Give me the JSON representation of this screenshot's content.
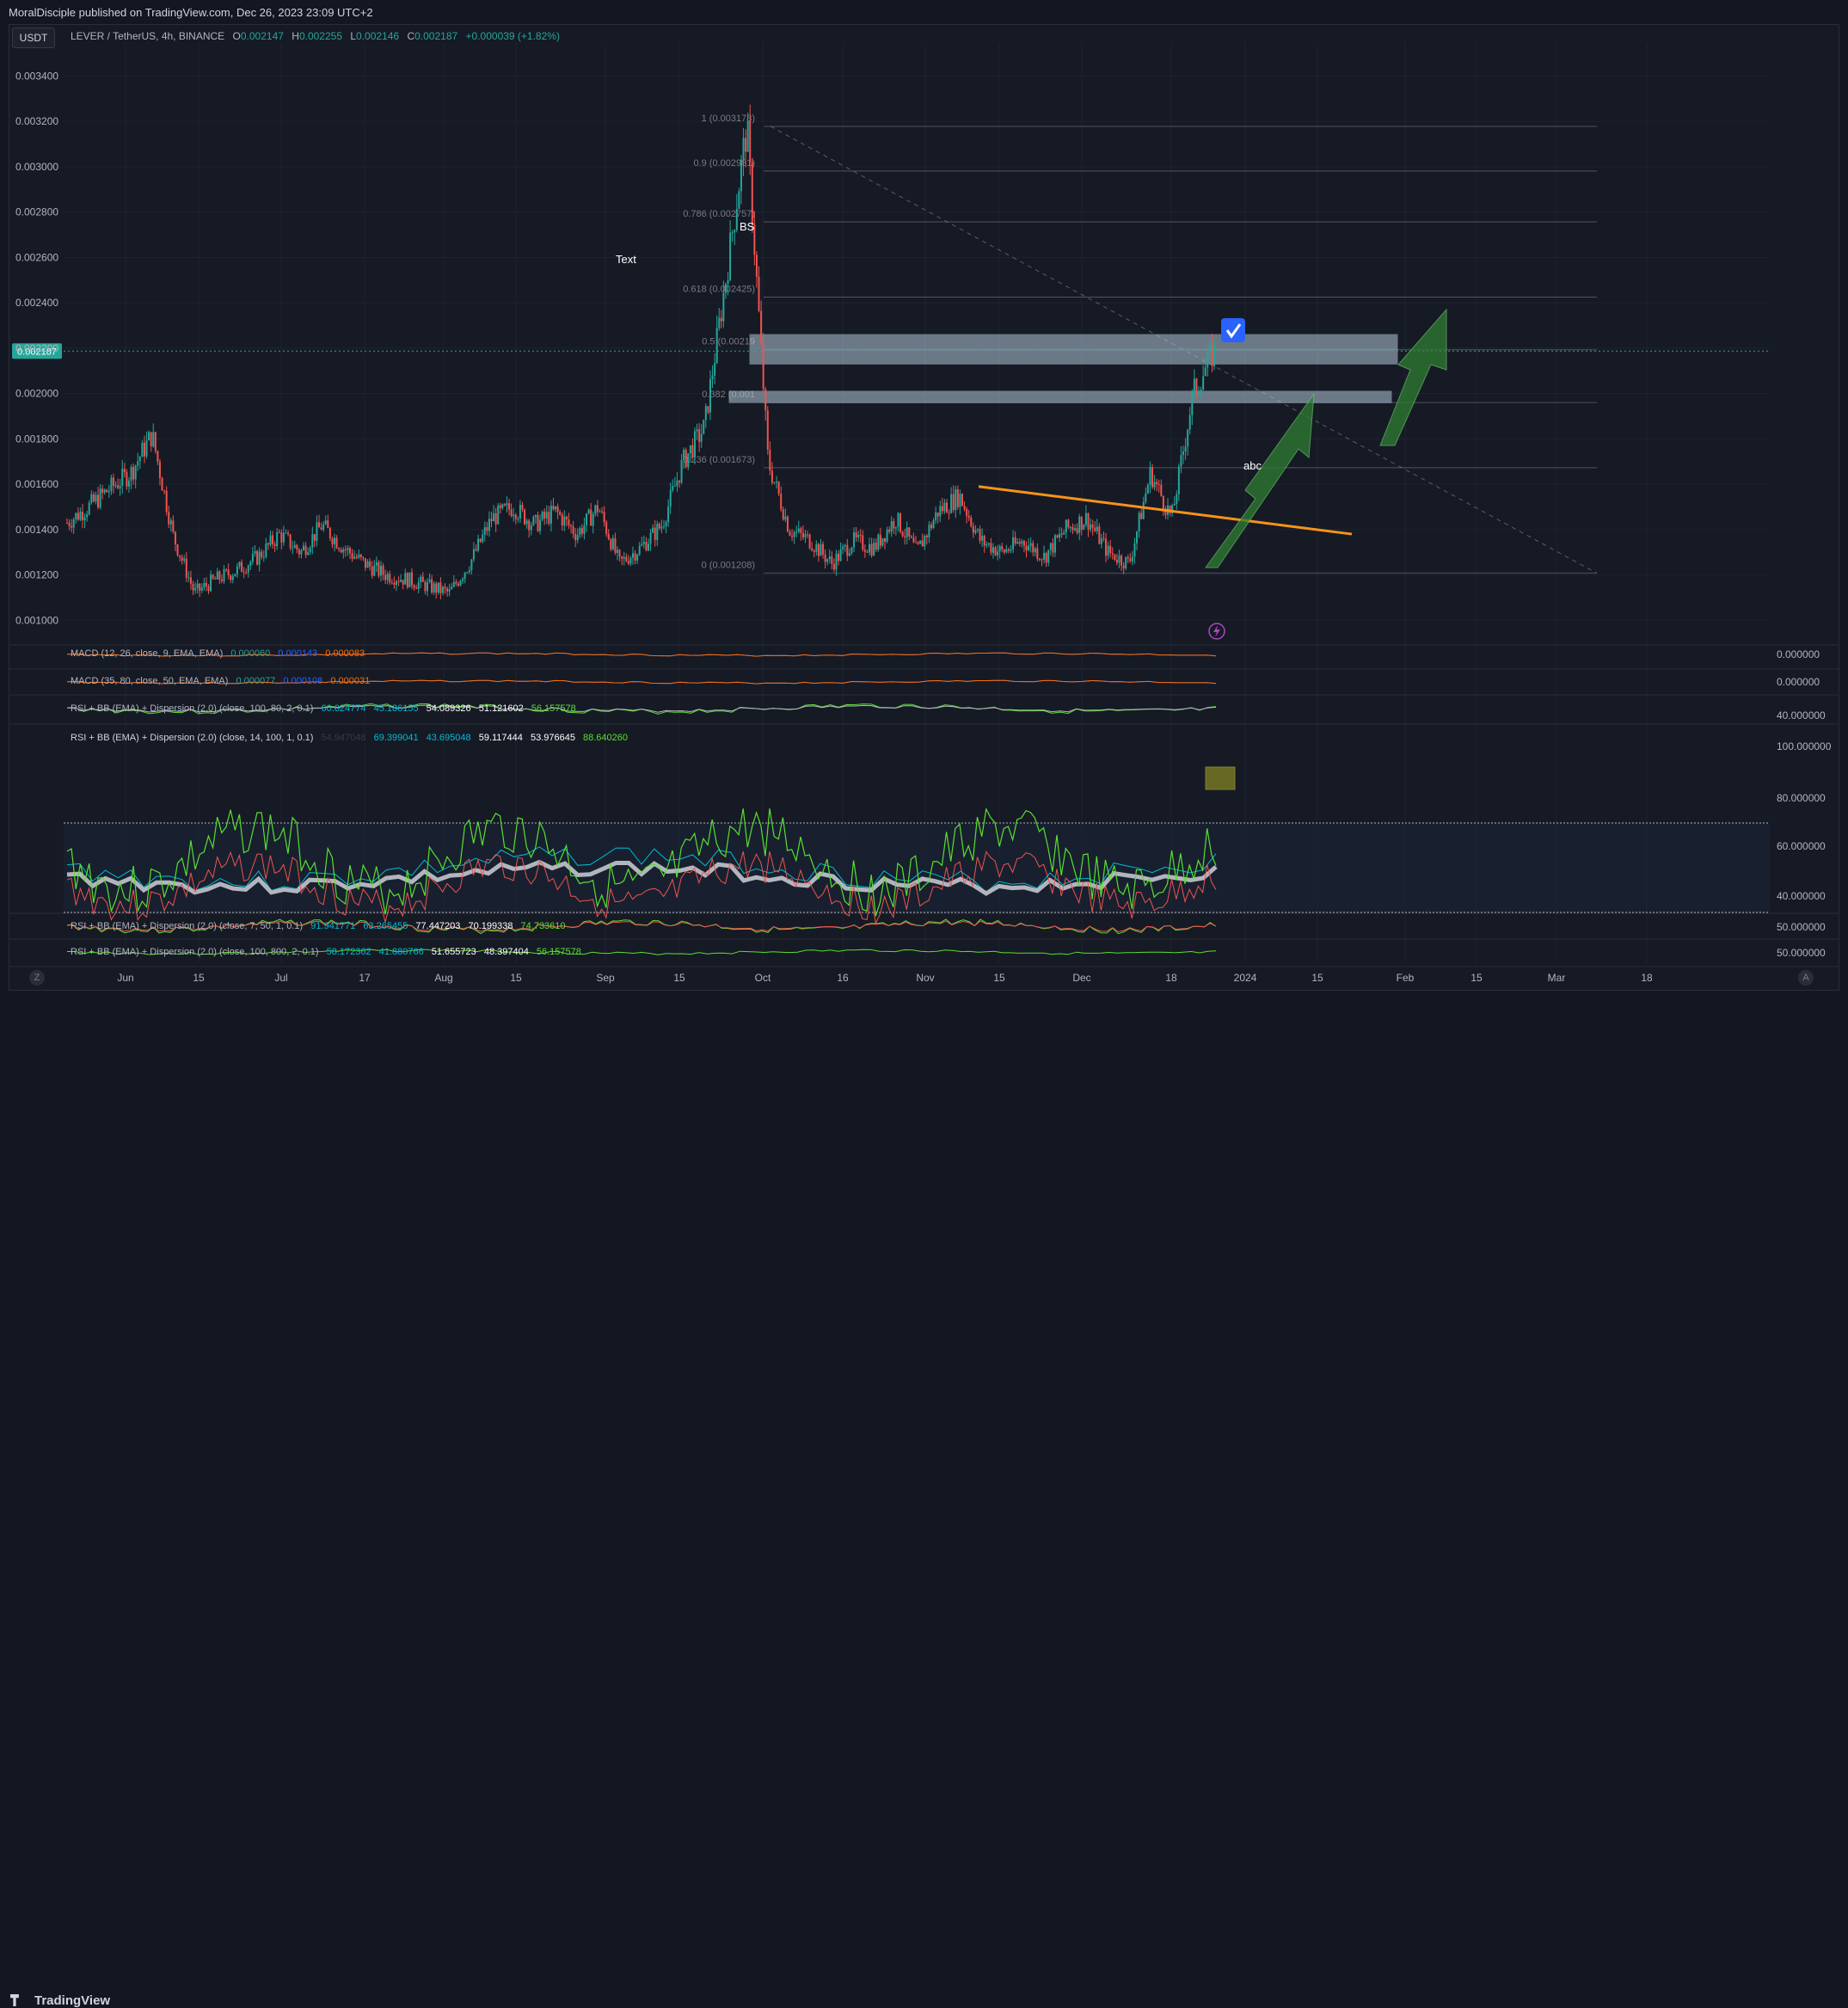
{
  "header": {
    "published": "MoralDisciple published on TradingView.com, Dec 26, 2023 23:09 UTC+2",
    "currency_button": "USDT"
  },
  "legend": {
    "symbol": "LEVER / TetherUS, 4h, BINANCE",
    "open_label": "O",
    "open": "0.002147",
    "high_label": "H",
    "high": "0.002255",
    "low_label": "L",
    "low": "0.002146",
    "close_label": "C",
    "close": "0.002187",
    "change": "+0.000039 (+1.82%)"
  },
  "indicators": [
    {
      "name": "MACD (12, 26, close, 9, EMA, EMA)",
      "values": [
        "0.000060",
        "0.000143",
        "0.000083"
      ],
      "axis_value": "0.000000"
    },
    {
      "name": "MACD (35, 80, close, 50, EMA, EMA)",
      "values": [
        "0.000077",
        "0.000108",
        "0.000031"
      ],
      "axis_value": "0.000000"
    },
    {
      "name": "RSI + BB (EMA) + Dispersion (2.0) (close, 100, 80, 2, 0.1)",
      "values": [
        "60.024774",
        "45.186155",
        "54.089326",
        "51.121602",
        "56.157578"
      ],
      "axis_value": "40.000000"
    },
    {
      "name": "RSI + BB (EMA) + Dispersion (2.0) (close, 14, 100, 1, 0.1)",
      "values": [
        "54.947048",
        "69.399041",
        "43.695048",
        "59.117444",
        "53.976645",
        "88.640260"
      ],
      "axis_values": [
        "100.000000",
        "80.000000",
        "60.000000",
        "40.000000"
      ]
    },
    {
      "name": "RSI + BB (EMA) + Dispersion (2.0) (close, 7, 50, 1, 0.1)",
      "values": [
        "91.941771",
        "63.265455",
        "77.447203",
        "70.199338",
        "74.733610"
      ],
      "axis_value": "50.000000"
    },
    {
      "name": "RSI + BB (EMA) + Dispersion (2.0) (close, 100, 800, 2, 0.1)",
      "values": [
        "58.172362",
        "41.880766",
        "51.655723",
        "48.397404",
        "56.157578"
      ],
      "axis_value": "50.000000"
    }
  ],
  "price_tag": "0.002187",
  "annotations": {
    "text1": "Text",
    "text2": "BS",
    "text3": "abc"
  },
  "fib_levels": [
    {
      "ratio": "1",
      "price": "0.003178",
      "label": "1 (0.003178)"
    },
    {
      "ratio": "0.9",
      "price": "0.002981",
      "label": "0.9 (0.002981)"
    },
    {
      "ratio": "0.786",
      "price": "0.002757",
      "label": "0.786 (0.002757)"
    },
    {
      "ratio": "0.618",
      "price": "0.002425",
      "label": "0.618 (0.002425)"
    },
    {
      "ratio": "0.5",
      "price": "0.002193",
      "label": "0.5 (0.00219"
    },
    {
      "ratio": "0.382",
      "price": "0.001960",
      "label": "0.382 (0.001"
    },
    {
      "ratio": "0.236",
      "price": "0.001673",
      "label": "0.236 (0.001673)"
    },
    {
      "ratio": "0",
      "price": "0.001208",
      "label": "0 (0.001208)"
    }
  ],
  "footer": {
    "brand": "TradingView",
    "left_btn": "Z",
    "right_btn": "A"
  },
  "colors": {
    "up": "#26a69a",
    "down": "#ef5350",
    "fib": "#787b86",
    "trendline": "#f7931a",
    "arrow": "#2e7d32",
    "zone": "#b2c7d8",
    "rsi_line": "#5adf30"
  },
  "chart_data": {
    "type": "candlestick",
    "y_axis": {
      "ylim": [
        0.00091,
        0.00347
      ],
      "ticks": [
        "0.001000",
        "0.001200",
        "0.001400",
        "0.001600",
        "0.001800",
        "0.002000",
        "0.002200",
        "0.002400",
        "0.002600",
        "0.002800",
        "0.003000",
        "0.003200",
        "0.003400"
      ]
    },
    "x_axis": {
      "ticks": [
        "Jun",
        "15",
        "Jul",
        "17",
        "Aug",
        "15",
        "Sep",
        "15",
        "Oct",
        "16",
        "Nov",
        "15",
        "Dec",
        "18",
        "2024",
        "15",
        "Feb",
        "15",
        "Mar",
        "18"
      ]
    },
    "price_series": {
      "name": "LEVER / TetherUS",
      "dates": [
        "May 22",
        "May 26",
        "Jun 1",
        "Jun 4",
        "Jun 8",
        "Jun 10",
        "Jun 15",
        "Jun 20",
        "Jun 25",
        "Jul 1",
        "Jul 8",
        "Jul 14",
        "Jul 17",
        "Jul 22",
        "Jul 27",
        "Aug 1",
        "Aug 5",
        "Aug 10",
        "Aug 14",
        "Aug 17",
        "Aug 20",
        "Aug 25",
        "Aug 30",
        "Sep 4",
        "Sep 8",
        "Sep 12",
        "Sep 17",
        "Sep 21",
        "Sep 24",
        "Sep 28",
        "Oct 1",
        "Oct 3",
        "Oct 5",
        "Oct 8",
        "Oct 12",
        "Oct 17",
        "Oct 21",
        "Oct 26",
        "Oct 31",
        "Nov 4",
        "Nov 8",
        "Nov 12",
        "Nov 16",
        "Nov 20",
        "Nov 24",
        "Nov 29",
        "Dec 3",
        "Dec 8",
        "Dec 12",
        "Dec 15",
        "Dec 18",
        "Dec 20",
        "Dec 22",
        "Dec 24",
        "Dec 26"
      ],
      "close": [
        0.00143,
        0.0015,
        0.00158,
        0.00165,
        0.00182,
        0.00137,
        0.00112,
        0.00118,
        0.00122,
        0.00128,
        0.00138,
        0.0013,
        0.00142,
        0.00132,
        0.00125,
        0.0012,
        0.00118,
        0.00115,
        0.00112,
        0.00126,
        0.00145,
        0.0015,
        0.00142,
        0.00148,
        0.00138,
        0.0015,
        0.00125,
        0.00132,
        0.00142,
        0.0017,
        0.00185,
        0.0025,
        0.00318,
        0.0017,
        0.0014,
        0.00135,
        0.00125,
        0.00135,
        0.00132,
        0.00145,
        0.0013,
        0.00148,
        0.00155,
        0.00135,
        0.0013,
        0.00135,
        0.00128,
        0.0014,
        0.00145,
        0.0013,
        0.00125,
        0.00165,
        0.00145,
        0.002,
        0.00219
      ]
    },
    "fib_retracement": {
      "high": 0.003178,
      "low": 0.001208
    },
    "zones": [
      {
        "from": 0.00213,
        "to": 0.00226
      },
      {
        "from": 0.00196,
        "to": 0.00201
      }
    ],
    "trendline": {
      "from": {
        "date": "Nov 11",
        "price": 0.00159
      },
      "to": {
        "date": "Dec 29",
        "price": 0.00138
      }
    },
    "rsi_levels": {
      "upper": 70,
      "lower": 30
    }
  }
}
